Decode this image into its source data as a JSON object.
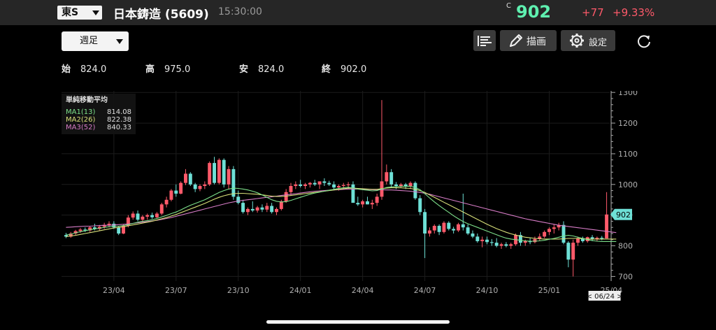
{
  "header": {
    "market": "東S",
    "stock_name": "日本鋳造 (5609)",
    "time": "15:30:00",
    "price_label": "C",
    "price": "902",
    "change": "+77",
    "change_pct": "+9.33%",
    "colors": {
      "up": "#ff5a6a",
      "price": "#5ff0b0"
    }
  },
  "toolbar": {
    "period": "週足",
    "draw_label": "描画",
    "settings_label": "設定",
    "icons": [
      "bar-list-icon",
      "pencil-icon",
      "gear-icon",
      "reload-icon"
    ]
  },
  "ohlc": {
    "open_label": "始",
    "open": "824.0",
    "high_label": "高",
    "high": "975.0",
    "low_label": "安",
    "low": "824.0",
    "close_label": "終",
    "close": "902.0"
  },
  "chart_data": {
    "type": "candlestick",
    "title": "",
    "legend": {
      "title": "単純移動平均",
      "position": "top-left",
      "items": [
        {
          "label": "MA1(13)",
          "value": "814.08",
          "color": "#7de08a"
        },
        {
          "label": "MA2(26)",
          "value": "822.38",
          "color": "#d8e07a"
        },
        {
          "label": "MA3(52)",
          "value": "840.33",
          "color": "#d77cc7"
        }
      ]
    },
    "y_ticks": [
      "1300",
      "1200",
      "1100",
      "1000",
      "900",
      "800",
      "700"
    ],
    "ylim": [
      685,
      1305
    ],
    "x_ticks": [
      "23/04",
      "23/07",
      "23/10",
      "24/01",
      "24/04",
      "24/07",
      "24/10",
      "25/01",
      "25/04"
    ],
    "x_tick_index": [
      10,
      23,
      36,
      49,
      62,
      75,
      88,
      101,
      114
    ],
    "current_price_label": "902",
    "current_date_label": "< 06/24 >",
    "colors": {
      "up": "#ff5a6a",
      "down": "#6ee0d6"
    },
    "candles": [
      [
        835,
        842,
        825,
        830
      ],
      [
        830,
        845,
        826,
        840
      ],
      [
        840,
        852,
        835,
        848
      ],
      [
        848,
        858,
        842,
        853
      ],
      [
        853,
        860,
        845,
        850
      ],
      [
        850,
        865,
        845,
        860
      ],
      [
        860,
        872,
        850,
        855
      ],
      [
        855,
        868,
        848,
        862
      ],
      [
        862,
        875,
        855,
        868
      ],
      [
        868,
        880,
        860,
        872
      ],
      [
        872,
        880,
        855,
        860
      ],
      [
        860,
        865,
        835,
        840
      ],
      [
        840,
        870,
        838,
        865
      ],
      [
        865,
        900,
        860,
        892
      ],
      [
        892,
        912,
        885,
        905
      ],
      [
        905,
        915,
        880,
        885
      ],
      [
        885,
        900,
        878,
        895
      ],
      [
        895,
        905,
        885,
        900
      ],
      [
        900,
        908,
        888,
        893
      ],
      [
        893,
        910,
        890,
        905
      ],
      [
        905,
        940,
        900,
        935
      ],
      [
        935,
        960,
        925,
        950
      ],
      [
        950,
        985,
        945,
        980
      ],
      [
        980,
        1000,
        960,
        970
      ],
      [
        970,
        1010,
        968,
        1005
      ],
      [
        1005,
        1050,
        998,
        1035
      ],
      [
        1035,
        1040,
        995,
        1000
      ],
      [
        1000,
        1005,
        975,
        985
      ],
      [
        985,
        1000,
        978,
        995
      ],
      [
        995,
        1010,
        985,
        1000
      ],
      [
        1000,
        1075,
        995,
        1070
      ],
      [
        1070,
        1090,
        1000,
        1005
      ],
      [
        1005,
        1085,
        1000,
        1080
      ],
      [
        1080,
        1085,
        990,
        1000
      ],
      [
        1000,
        1060,
        985,
        1050
      ],
      [
        1050,
        1060,
        950,
        960
      ],
      [
        960,
        980,
        935,
        940
      ],
      [
        940,
        950,
        905,
        910
      ],
      [
        910,
        925,
        900,
        920
      ],
      [
        920,
        945,
        910,
        915
      ],
      [
        915,
        930,
        908,
        925
      ],
      [
        925,
        935,
        910,
        918
      ],
      [
        918,
        940,
        910,
        930
      ],
      [
        930,
        940,
        905,
        910
      ],
      [
        910,
        925,
        900,
        920
      ],
      [
        920,
        950,
        915,
        945
      ],
      [
        945,
        985,
        940,
        975
      ],
      [
        975,
        1005,
        965,
        995
      ],
      [
        995,
        1010,
        985,
        1000
      ],
      [
        1000,
        1015,
        990,
        995
      ],
      [
        995,
        1005,
        985,
        1000
      ],
      [
        1000,
        1008,
        990,
        1005
      ],
      [
        1005,
        1015,
        995,
        1000
      ],
      [
        1000,
        1010,
        985,
        1010
      ],
      [
        1010,
        1020,
        995,
        1005
      ],
      [
        1005,
        1012,
        995,
        1000
      ],
      [
        1000,
        1010,
        985,
        990
      ],
      [
        990,
        1000,
        980,
        995
      ],
      [
        995,
        1005,
        985,
        998
      ],
      [
        998,
        1008,
        985,
        1000
      ],
      [
        1000,
        1010,
        990,
        940
      ],
      [
        940,
        960,
        930,
        935
      ],
      [
        935,
        950,
        925,
        945
      ],
      [
        945,
        960,
        935,
        935
      ],
      [
        935,
        950,
        920,
        940
      ],
      [
        940,
        970,
        930,
        960
      ],
      [
        960,
        1275,
        950,
        1010
      ],
      [
        1010,
        1065,
        1000,
        1040
      ],
      [
        1040,
        1050,
        990,
        1000
      ],
      [
        1000,
        1008,
        985,
        995
      ],
      [
        995,
        1005,
        990,
        1000
      ],
      [
        1000,
        1005,
        985,
        995
      ],
      [
        995,
        1010,
        985,
        1005
      ],
      [
        1005,
        1010,
        950,
        955
      ],
      [
        955,
        965,
        900,
        910
      ],
      [
        910,
        920,
        760,
        840
      ],
      [
        840,
        860,
        830,
        850
      ],
      [
        850,
        870,
        840,
        865
      ],
      [
        865,
        870,
        835,
        845
      ],
      [
        845,
        880,
        840,
        875
      ],
      [
        875,
        880,
        850,
        855
      ],
      [
        855,
        862,
        840,
        850
      ],
      [
        850,
        875,
        845,
        870
      ],
      [
        870,
        970,
        850,
        860
      ],
      [
        860,
        870,
        835,
        840
      ],
      [
        840,
        850,
        825,
        830
      ],
      [
        830,
        840,
        810,
        815
      ],
      [
        815,
        830,
        795,
        820
      ],
      [
        820,
        830,
        805,
        812
      ],
      [
        812,
        822,
        800,
        810
      ],
      [
        810,
        825,
        795,
        800
      ],
      [
        800,
        810,
        790,
        805
      ],
      [
        805,
        812,
        795,
        800
      ],
      [
        800,
        810,
        790,
        805
      ],
      [
        805,
        840,
        800,
        835
      ],
      [
        835,
        845,
        800,
        810
      ],
      [
        810,
        820,
        800,
        815
      ],
      [
        815,
        825,
        805,
        812
      ],
      [
        812,
        830,
        808,
        822
      ],
      [
        822,
        840,
        815,
        830
      ],
      [
        830,
        850,
        825,
        845
      ],
      [
        845,
        860,
        835,
        855
      ],
      [
        855,
        870,
        840,
        860
      ],
      [
        860,
        875,
        850,
        868
      ],
      [
        868,
        880,
        805,
        810
      ],
      [
        810,
        815,
        730,
        755
      ],
      [
        755,
        820,
        700,
        810
      ],
      [
        810,
        830,
        800,
        825
      ],
      [
        825,
        830,
        810,
        815
      ],
      [
        815,
        830,
        810,
        828
      ],
      [
        828,
        835,
        815,
        822
      ],
      [
        822,
        830,
        815,
        826
      ],
      [
        826,
        832,
        818,
        824
      ],
      [
        824,
        975,
        824,
        902
      ]
    ],
    "ma1": [
      835,
      838,
      842,
      846,
      849,
      852,
      855,
      857,
      860,
      862,
      864,
      864,
      866,
      869,
      873,
      877,
      880,
      882,
      885,
      889,
      894,
      899,
      905,
      910,
      917,
      925,
      932,
      938,
      944,
      950,
      958,
      966,
      974,
      980,
      985,
      988,
      987,
      985,
      982,
      978,
      973,
      966,
      958,
      950,
      945,
      943,
      944,
      948,
      953,
      958,
      963,
      968,
      972,
      975,
      978,
      981,
      984,
      987,
      989,
      991,
      988,
      985,
      983,
      981,
      979,
      980,
      985,
      990,
      992,
      993,
      994,
      994,
      994,
      990,
      983,
      970,
      956,
      943,
      931,
      920,
      909,
      898,
      888,
      879,
      872,
      866,
      860,
      854,
      848,
      842,
      836,
      830,
      825,
      822,
      820,
      818,
      816,
      815,
      815,
      816,
      818,
      821,
      824,
      828,
      832,
      834,
      832,
      828,
      824,
      820,
      817,
      815,
      814,
      814,
      814,
      814
    ],
    "ma2": [
      830,
      832,
      834,
      837,
      840,
      843,
      846,
      849,
      852,
      855,
      858,
      860,
      862,
      865,
      868,
      871,
      874,
      877,
      880,
      884,
      888,
      892,
      897,
      902,
      908,
      914,
      920,
      926,
      932,
      938,
      945,
      952,
      958,
      963,
      967,
      970,
      971,
      971,
      970,
      969,
      968,
      966,
      964,
      962,
      961,
      961,
      962,
      964,
      966,
      968,
      970,
      972,
      974,
      976,
      978,
      980,
      982,
      984,
      986,
      988,
      988,
      987,
      986,
      985,
      984,
      984,
      986,
      988,
      989,
      989,
      989,
      988,
      987,
      984,
      980,
      974,
      966,
      958,
      950,
      942,
      934,
      926,
      918,
      910,
      902,
      894,
      886,
      878,
      870,
      863,
      856,
      850,
      844,
      839,
      835,
      831,
      828,
      826,
      824,
      823,
      822,
      822,
      822,
      822,
      823,
      824,
      824,
      824,
      823,
      822,
      822,
      822,
      822,
      822,
      822,
      822
    ],
    "ma3": [
      860,
      861,
      862,
      863,
      864,
      864,
      865,
      866,
      867,
      867,
      868,
      869,
      870,
      871,
      873,
      875,
      877,
      879,
      881,
      883,
      886,
      889,
      892,
      896,
      900,
      904,
      908,
      912,
      916,
      920,
      924,
      928,
      932,
      936,
      940,
      943,
      946,
      948,
      950,
      952,
      954,
      956,
      958,
      960,
      962,
      964,
      966,
      968,
      970,
      972,
      974,
      976,
      978,
      979,
      980,
      981,
      982,
      983,
      984,
      985,
      985,
      985,
      984,
      984,
      983,
      983,
      983,
      982,
      982,
      981,
      980,
      979,
      978,
      976,
      974,
      971,
      968,
      964,
      960,
      956,
      952,
      948,
      944,
      940,
      936,
      932,
      928,
      924,
      920,
      916,
      912,
      908,
      904,
      900,
      896,
      892,
      888,
      885,
      882,
      879,
      876,
      873,
      870,
      867,
      865,
      863,
      861,
      859,
      857,
      855,
      853,
      851,
      849,
      847,
      845,
      843
    ]
  }
}
